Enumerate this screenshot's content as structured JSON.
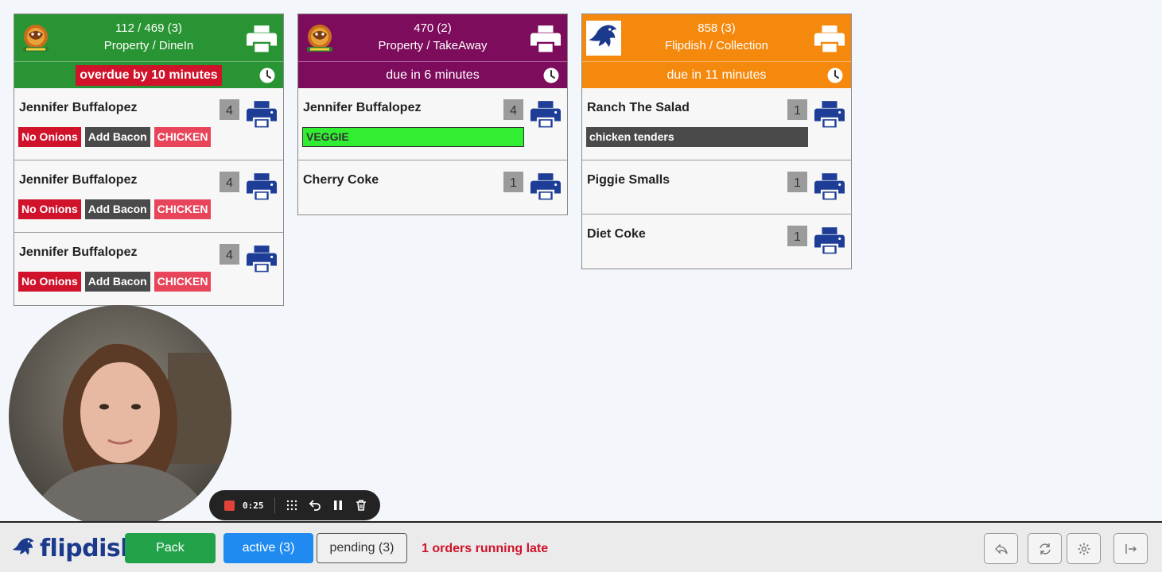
{
  "orders": [
    {
      "header_line1": "112 / 469 (3)",
      "header_line2": "Property / DineIn",
      "header_color": "#299433",
      "due_color": "#299433",
      "due_text": "overdue by 10 minutes",
      "overdue": true,
      "logo_icon": "property-logo-icon",
      "items": [
        {
          "name": "Jennifer Buffalopez",
          "qty": "4",
          "mods": [
            "No Onions",
            "Add Bacon",
            "CHICKEN"
          ]
        },
        {
          "name": "Jennifer Buffalopez",
          "qty": "4",
          "mods": [
            "No Onions",
            "Add Bacon",
            "CHICKEN"
          ]
        },
        {
          "name": "Jennifer Buffalopez",
          "qty": "4",
          "mods": [
            "No Onions",
            "Add Bacon",
            "CHICKEN"
          ]
        }
      ]
    },
    {
      "header_line1": "470 (2)",
      "header_line2": "Property / TakeAway",
      "header_color": "#7d0c5c",
      "due_color": "#7d0c5c",
      "due_text": "due in 6 minutes",
      "overdue": false,
      "logo_icon": "property-logo-icon",
      "items": [
        {
          "name": "Jennifer Buffalopez",
          "qty": "4",
          "mods": [
            "VEGGIE"
          ]
        },
        {
          "name": "Cherry Coke",
          "qty": "1",
          "mods": []
        }
      ]
    },
    {
      "header_line1": "858 (3)",
      "header_line2": "Flipdish / Collection",
      "header_color": "#f5890e",
      "due_color": "#f5890e",
      "due_text": "due in 11 minutes",
      "overdue": false,
      "logo_icon": "flipdish-logo-icon",
      "items": [
        {
          "name": "Ranch The Salad",
          "qty": "1",
          "mods": [
            "chicken tenders"
          ]
        },
        {
          "name": "Piggie Smalls",
          "qty": "1",
          "mods": []
        },
        {
          "name": "Diet Coke",
          "qty": "1",
          "mods": []
        }
      ]
    }
  ],
  "recorder": {
    "time": "0:25"
  },
  "footer": {
    "brand": "flipdish",
    "pack_label": "Pack",
    "active_label": "active (3)",
    "pending_label": "pending (3)",
    "late_text": "1 orders running late"
  },
  "colors": {
    "print_blue": "#1d3d97",
    "late_red": "#d0122a",
    "active_blue": "#1f8bf0",
    "pack_green": "#22a34a"
  }
}
